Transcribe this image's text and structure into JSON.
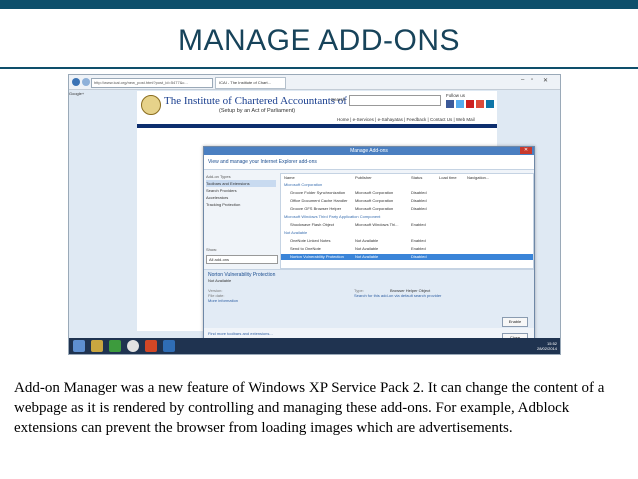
{
  "slide": {
    "title": "MANAGE ADD-ONS",
    "caption": "Add-on Manager was a new feature of Windows XP Service Pack 2. It can change the content of a webpage as it is rendered by controlling and  managing these add-ons. For example, Adblock extensions can prevent the browser from loading images which are advertisements.",
    "accent_color": "#0e4f6b",
    "title_color": "#17435a"
  },
  "browser": {
    "address": "http://www.icai.org/new_post.html?post_id=5477&c...",
    "tab_label": "ICAI - The Institute of Chart...",
    "google_label": "Google+"
  },
  "website": {
    "name": "The Institute of Chartered Accountants of India",
    "subtitle": "(Setup by an Act of Parliament)",
    "search_label": "Search",
    "follow_label": "Follow us",
    "nav": "Home | e-Services | e-Sahayatas | Feedback | Contact Us | Web Mail"
  },
  "dialog": {
    "title": "Manage Add-ons",
    "header": "View and manage your Internet Explorer add-ons",
    "addon_types_label": "Add-on Types",
    "addon_types": [
      "Toolbars and Extensions",
      "Search Providers",
      "Accelerators",
      "Tracking Protection"
    ],
    "show_label": "Show:",
    "show_value": "All add-ons",
    "columns": {
      "name": "Name",
      "publisher": "Publisher",
      "status": "Status",
      "load_time": "Load time",
      "navigation": "Navigation..."
    },
    "rows": [
      {
        "kind": "group",
        "name": "Microsoft Corporation"
      },
      {
        "kind": "item",
        "name": "Groove Folder Synchronization",
        "publisher": "Microsoft Corporation",
        "status": "Disabled"
      },
      {
        "kind": "item",
        "name": "Office Document Cache Handler",
        "publisher": "Microsoft Corporation",
        "status": "Disabled"
      },
      {
        "kind": "item",
        "name": "Groove GFS Browser Helper",
        "publisher": "Microsoft Corporation",
        "status": "Disabled"
      },
      {
        "kind": "group",
        "name": "Microsoft Windows Third Party Application Component"
      },
      {
        "kind": "item",
        "name": "Shockwave Flash Object",
        "publisher": "Microsoft Windows Thi...",
        "status": "Enabled"
      },
      {
        "kind": "group",
        "name": "Not Available"
      },
      {
        "kind": "item",
        "name": "OneNote Linked Notes",
        "publisher": "Not Available",
        "status": "Enabled"
      },
      {
        "kind": "item",
        "name": "Send to OneNote",
        "publisher": "Not Available",
        "status": "Enabled"
      },
      {
        "kind": "selected",
        "name": "Norton Vulnerability Protection",
        "publisher": "Not Available",
        "status": "Disabled"
      }
    ],
    "details": {
      "title": "Norton Vulnerability Protection",
      "subtitle": "Not Available",
      "version_label": "Version:",
      "file_date_label": "File date:",
      "more_info": "More information",
      "type_label": "Type:",
      "type_value": "Browser Helper Object",
      "search_link": "Search for this add-on via default search provider"
    },
    "enable_button": "Enable",
    "close_button": "Close",
    "find_more": "Find more toolbars and extensions...",
    "learn_more": "Learn more about toolbars and extensions"
  },
  "taskbar": {
    "time": "15:52",
    "date": "28/02/2014"
  }
}
